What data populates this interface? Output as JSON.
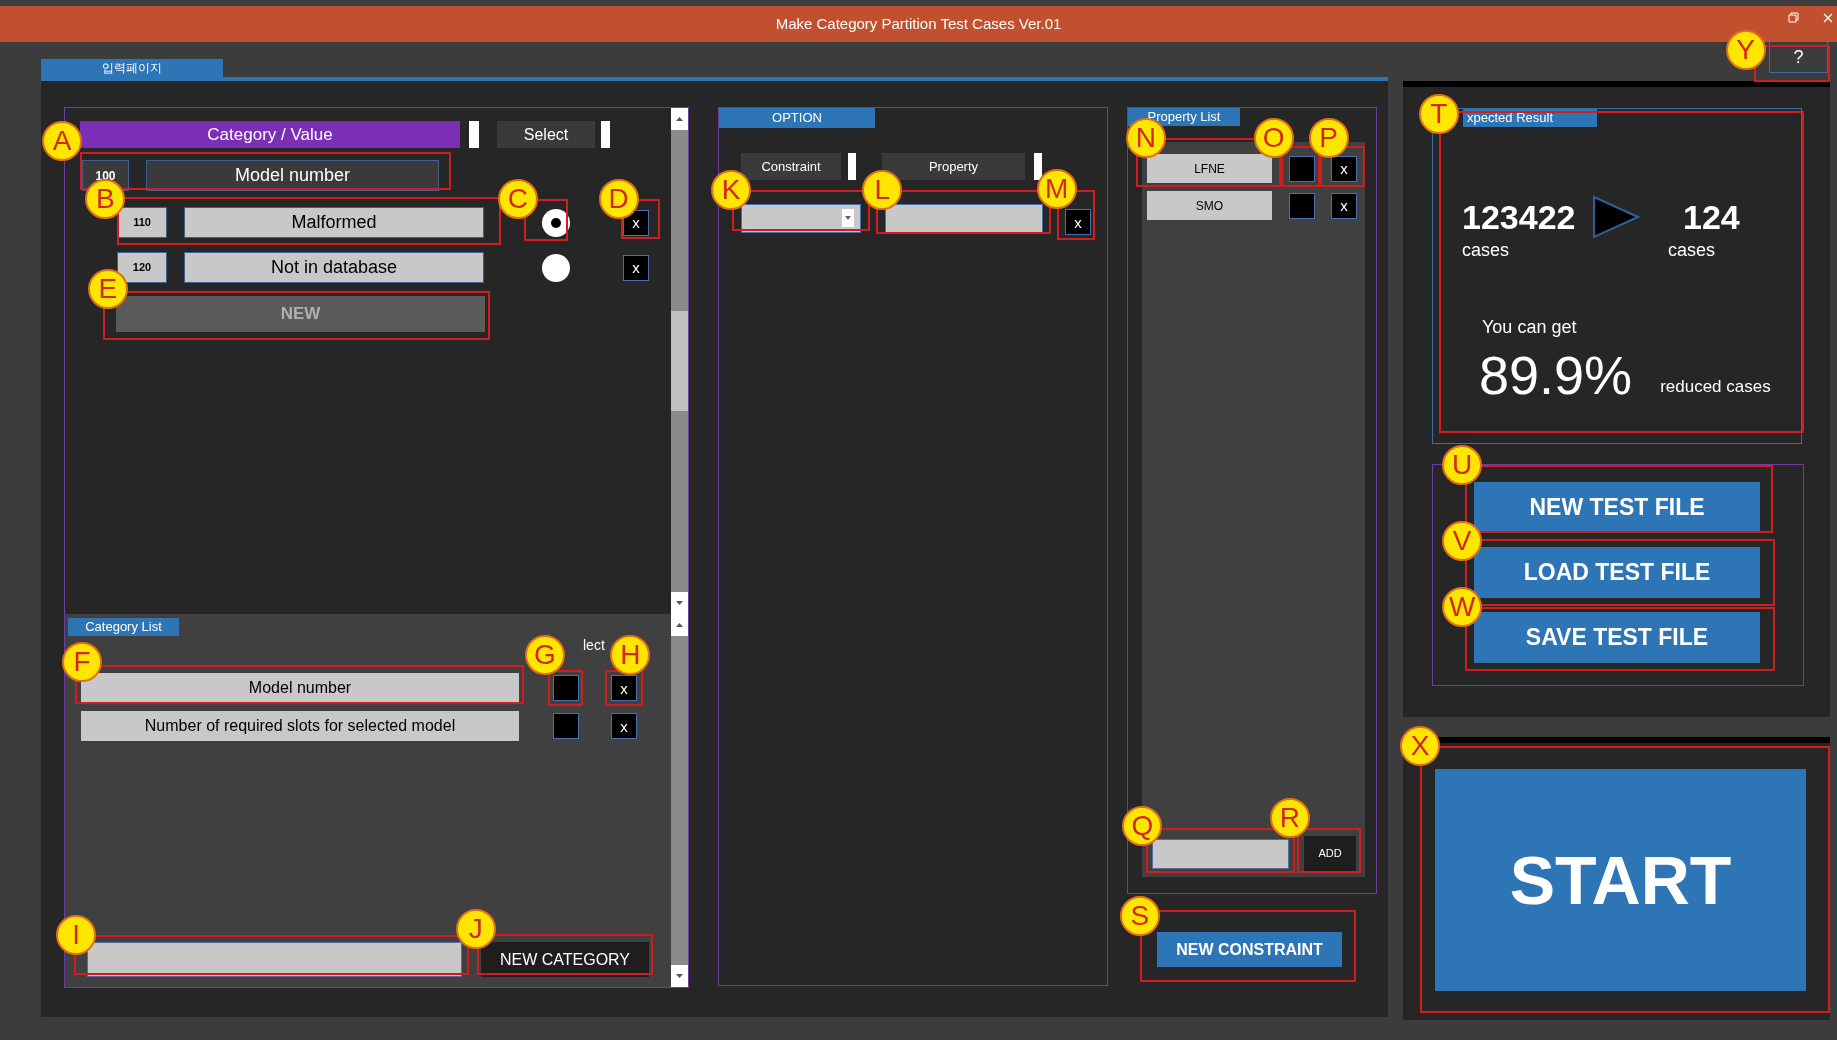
{
  "window": {
    "title": "Make Category Partition Test Cases Ver.01"
  },
  "help_button": "?",
  "tabs": [
    {
      "label": "입력페이지",
      "selected": true
    }
  ],
  "category_value": {
    "header": "Category / Value",
    "select_header": "Select",
    "category": {
      "code": "100",
      "name": "Model number"
    },
    "values": [
      {
        "code": "110",
        "name": "Malformed",
        "selected": true,
        "delete": "x"
      },
      {
        "code": "120",
        "name": "Not in database",
        "selected": false,
        "delete": "x"
      }
    ],
    "new_button": "NEW"
  },
  "category_list": {
    "title": "Category List",
    "select_header": "lect",
    "items": [
      {
        "name": "Model number",
        "checked": false,
        "delete": "x"
      },
      {
        "name": "Number of required slots for selected model",
        "checked": false,
        "delete": "x"
      }
    ],
    "new_button": "NEW CATEGORY"
  },
  "option": {
    "title": "OPTION",
    "columns": [
      "Constraint",
      "Property"
    ],
    "delete": "x"
  },
  "property_list": {
    "title": "Property List",
    "items": [
      {
        "name": "LFNE",
        "checked": false,
        "delete": "x"
      },
      {
        "name": "SMO",
        "checked": false,
        "delete": "x"
      }
    ],
    "add_button": "ADD"
  },
  "new_constraint_button": "NEW CONSTRAINT",
  "expected_result": {
    "title": "xpected Result",
    "from_count": "123422",
    "from_unit": "cases",
    "to_count": "124",
    "to_unit": "cases",
    "caption": "You can get",
    "percent": "89.9%",
    "percent_caption": "reduced cases"
  },
  "file_buttons": [
    "NEW TEST FILE",
    "LOAD TEST FILE",
    "SAVE TEST FILE"
  ],
  "start_button": "START",
  "annotations": [
    {
      "label": "A"
    },
    {
      "label": "B"
    },
    {
      "label": "C"
    },
    {
      "label": "D"
    },
    {
      "label": "E"
    },
    {
      "label": "F"
    },
    {
      "label": "G"
    },
    {
      "label": "H"
    },
    {
      "label": "I"
    },
    {
      "label": "J"
    },
    {
      "label": "K"
    },
    {
      "label": "L"
    },
    {
      "label": "M"
    },
    {
      "label": "N"
    },
    {
      "label": "O"
    },
    {
      "label": "P"
    },
    {
      "label": "Q"
    },
    {
      "label": "R"
    },
    {
      "label": "S"
    },
    {
      "label": "T"
    },
    {
      "label": "U"
    },
    {
      "label": "V"
    },
    {
      "label": "W"
    },
    {
      "label": "X"
    },
    {
      "label": "Y"
    }
  ]
}
